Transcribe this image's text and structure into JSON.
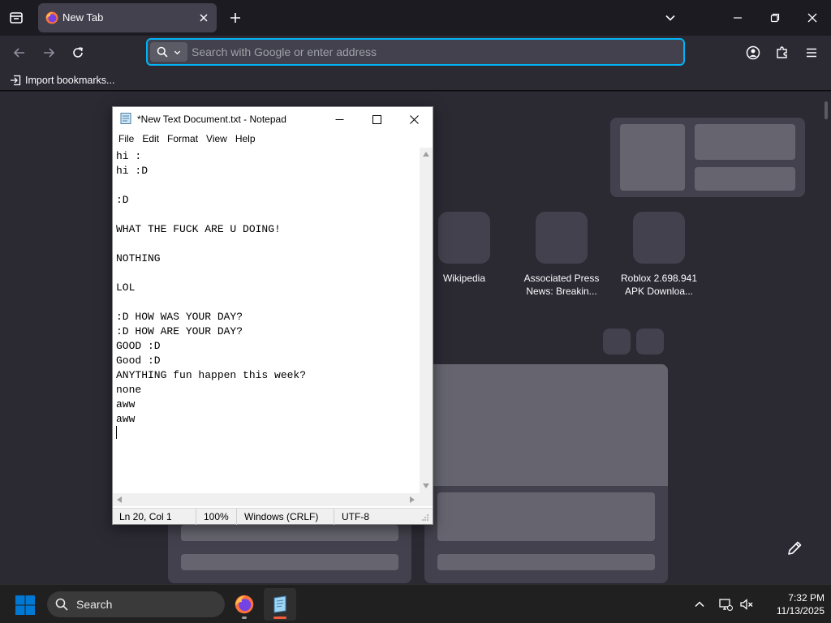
{
  "browser": {
    "tab": {
      "title": "New Tab"
    },
    "urlbar": {
      "placeholder": "Search with Google or enter address"
    },
    "bookmarks": {
      "import_label": "Import bookmarks..."
    },
    "colors": {
      "chrome": "#1c1b22",
      "toolbar": "#2b2a33",
      "tab_active": "#42414d",
      "focus_ring": "#00b3f4"
    }
  },
  "newtab": {
    "shortcuts": [
      {
        "label": "Wikipedia"
      },
      {
        "label": "Associated Press\nNews: Breakin..."
      },
      {
        "label": "Roblox 2.698.941\nAPK Downloa..."
      }
    ]
  },
  "notepad": {
    "title": "*New Text Document.txt - Notepad",
    "menu": [
      "File",
      "Edit",
      "Format",
      "View",
      "Help"
    ],
    "content": "hi :\nhi :D\n\n:D\n\nWHAT THE FUCK ARE U DOING!\n\nNOTHING\n\nLOL\n\n:D HOW WAS YOUR DAY?\n:D HOW ARE YOUR DAY?\nGOOD :D\nGood :D\nANYTHING fun happen this week?\nnone\naww\naww\n",
    "status": {
      "position": "Ln 20, Col 1",
      "zoom": "100%",
      "line_ending": "Windows (CRLF)",
      "encoding": "UTF-8"
    }
  },
  "taskbar": {
    "search_label": "Search",
    "time": "7:32 PM",
    "date": "11/13/2025",
    "colors": {
      "background": "#202020",
      "start_blue": "#0078d4",
      "notepad_indicator": "#f25c3c"
    }
  }
}
